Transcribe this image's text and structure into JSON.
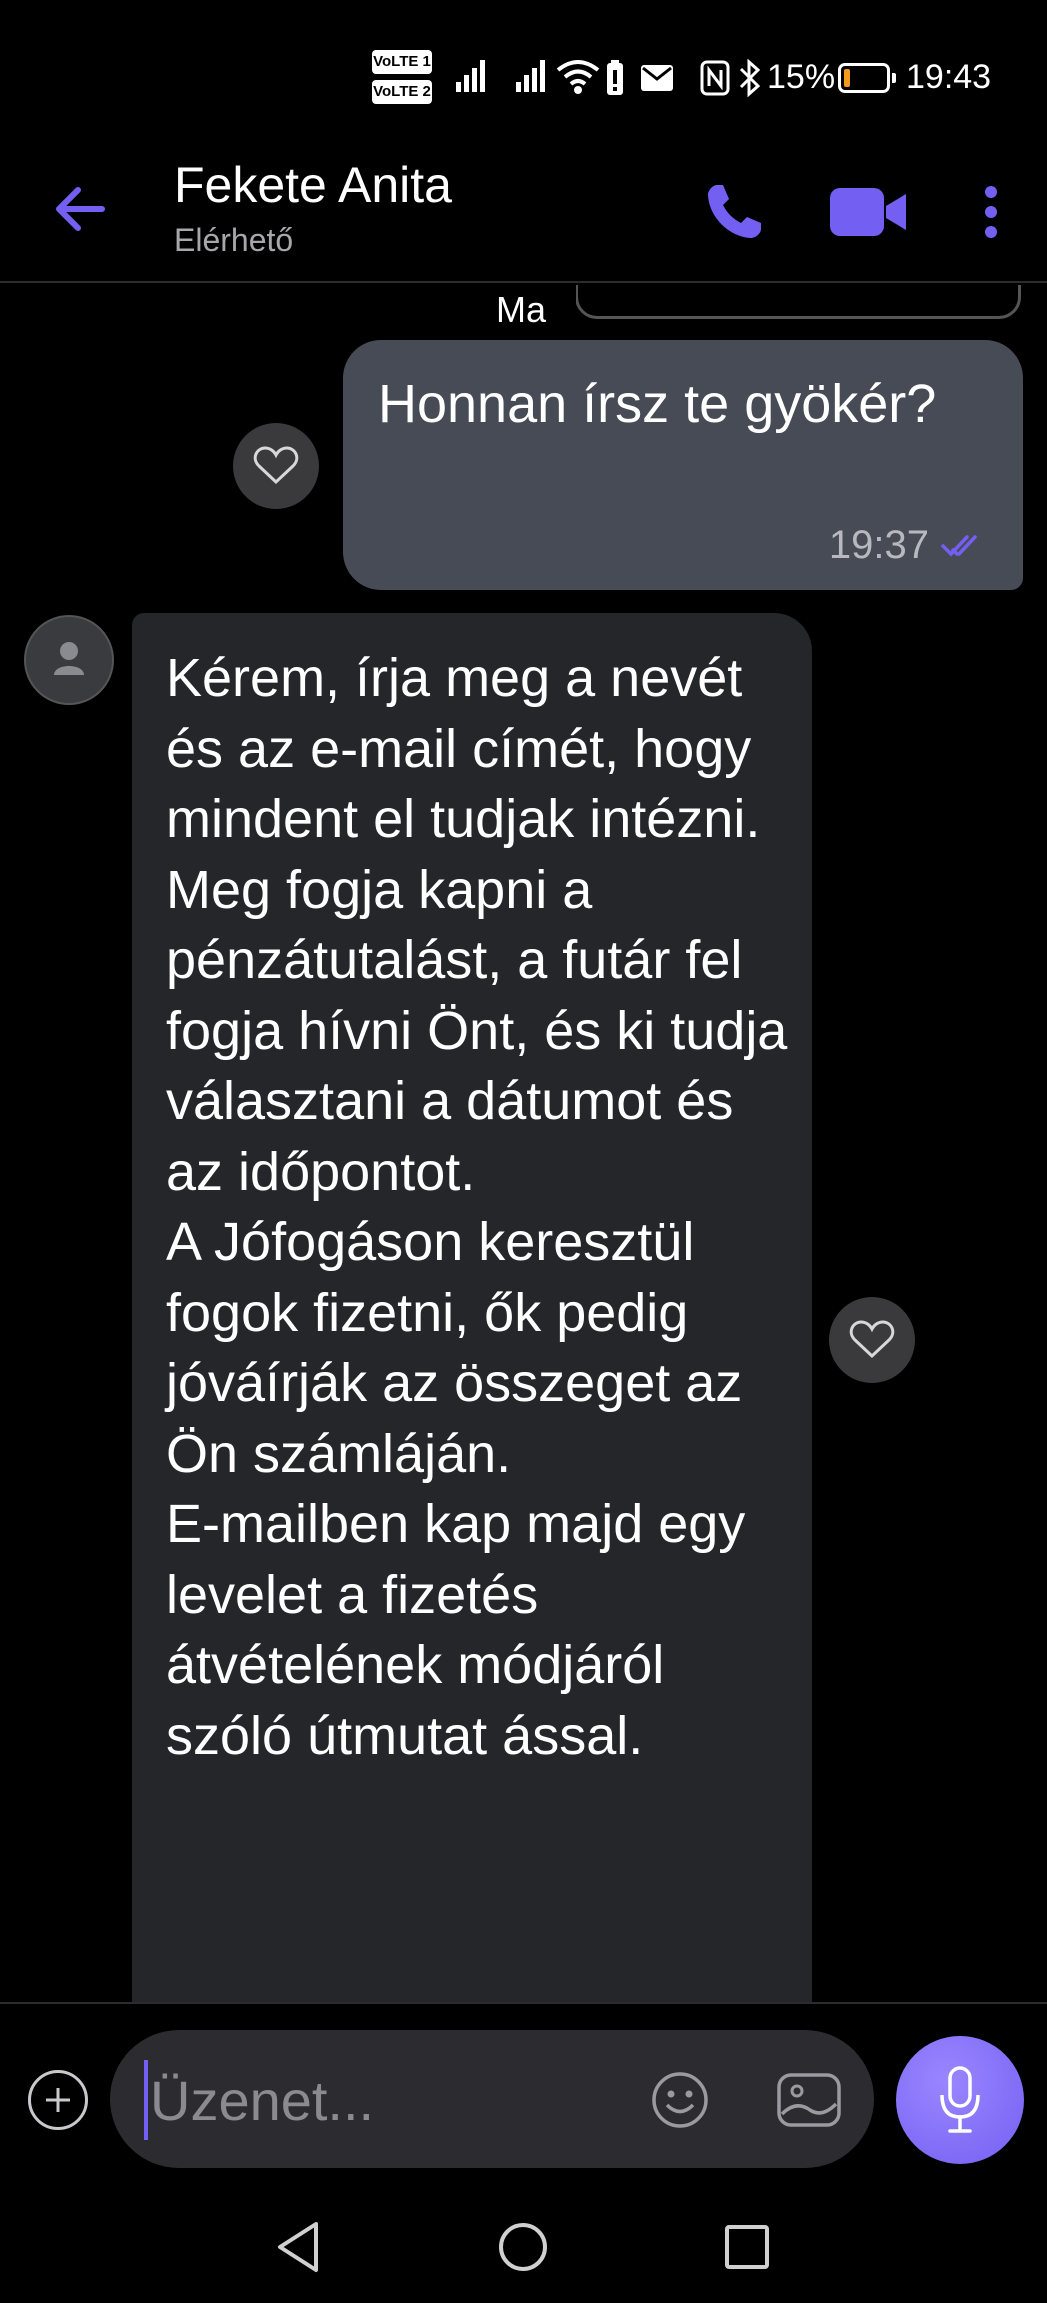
{
  "status_bar": {
    "volte1": "VoLTE 1",
    "volte2": "VoLTE 2",
    "battery_pct": "15%",
    "battery_level": 0.15,
    "time": "19:43",
    "icons": [
      "signal-icon",
      "signal-icon",
      "wifi-icon",
      "battery-saver-icon",
      "mail-icon",
      "nfc-icon",
      "bluetooth-icon"
    ]
  },
  "header": {
    "contact_name": "Fekete Anita",
    "status": "Elérhető",
    "accent": "#7360f2"
  },
  "chat": {
    "date_chip": "Ma",
    "messages": [
      {
        "direction": "outgoing",
        "text": "Honnan írsz te gyökér?",
        "time": "19:37",
        "read_receipt": "double-check-icon"
      },
      {
        "direction": "incoming",
        "text": "Kérem, írja meg a nevét és az e-mail címét, hogy mindent el tudjak intézni.\nMeg fogja kapni a pénzátutalást, a futár fel fogja hívni Önt, és ki tudja választani a dátumot és az időpontot.\nA Jófogáson keresztül fogok fizetni, ők pedig jóváírják az összeget az Ön számláján.\nE-mailben kap majd egy levelet a fizetés átvételének módjáról szóló útmutat ással."
      }
    ]
  },
  "composer": {
    "placeholder": "Üzenet...",
    "value": ""
  }
}
